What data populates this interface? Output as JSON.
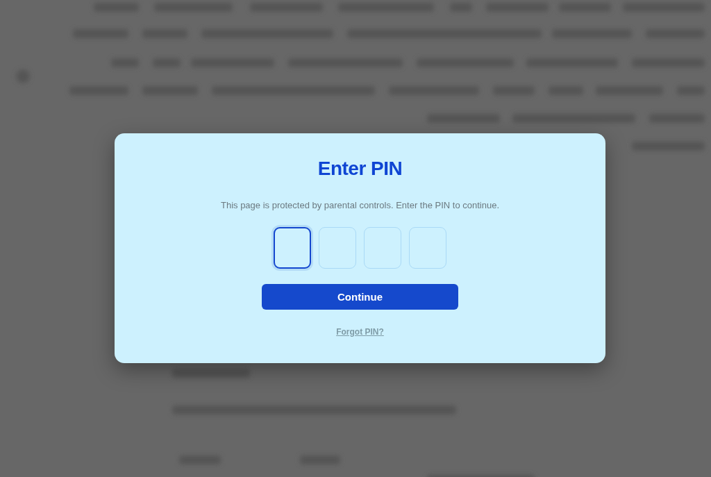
{
  "dialog": {
    "title": "Enter PIN",
    "message": "This page is protected by parental controls. Enter the PIN to continue.",
    "pin_fields": [
      {
        "focused": true
      },
      {
        "focused": false
      },
      {
        "focused": false
      },
      {
        "focused": false
      }
    ],
    "primary_button": "Continue",
    "link": "Forgot PIN?"
  }
}
